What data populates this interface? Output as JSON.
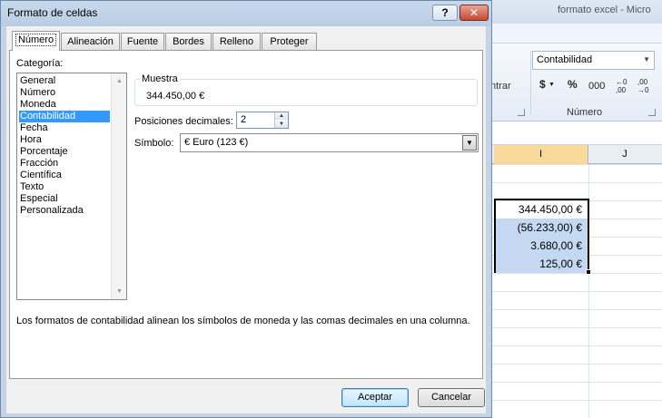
{
  "excel": {
    "window_title": "formato excel  -  Micro",
    "number_format_box": "Contabilidad",
    "centrar_label": "ntrar",
    "currency_button": "$",
    "percent_button": "%",
    "thousands_button": "000",
    "decrease_decimals_label": "←0 ,00",
    "increase_decimals_label": ",00 →0",
    "group_label": "Número",
    "columns": [
      "I",
      "J"
    ],
    "cells": [
      "344.450,00  €",
      "(56.233,00) €",
      "3.680,00  €",
      "125,00  €"
    ]
  },
  "dialog": {
    "title": "Formato de celdas",
    "help_button": "?",
    "close_button": "✕",
    "tabs": [
      "Número",
      "Alineación",
      "Fuente",
      "Bordes",
      "Relleno",
      "Proteger"
    ],
    "active_tab": "Número",
    "category_label": "Categoría:",
    "categories": [
      "General",
      "Número",
      "Moneda",
      "Contabilidad",
      "Fecha",
      "Hora",
      "Porcentaje",
      "Fracción",
      "Científica",
      "Texto",
      "Especial",
      "Personalizada"
    ],
    "selected_category": "Contabilidad",
    "sample_label": "Muestra",
    "sample_value": "344.450,00  €",
    "decimal_places_label": "Posiciones decimales:",
    "decimal_places_value": "2",
    "symbol_label": "Símbolo:",
    "symbol_value": "€ Euro (123 €)",
    "description": "Los formatos de contabilidad alinean los símbolos de moneda y las comas decimales en una columna.",
    "ok_button": "Aceptar",
    "cancel_button": "Cancelar"
  }
}
